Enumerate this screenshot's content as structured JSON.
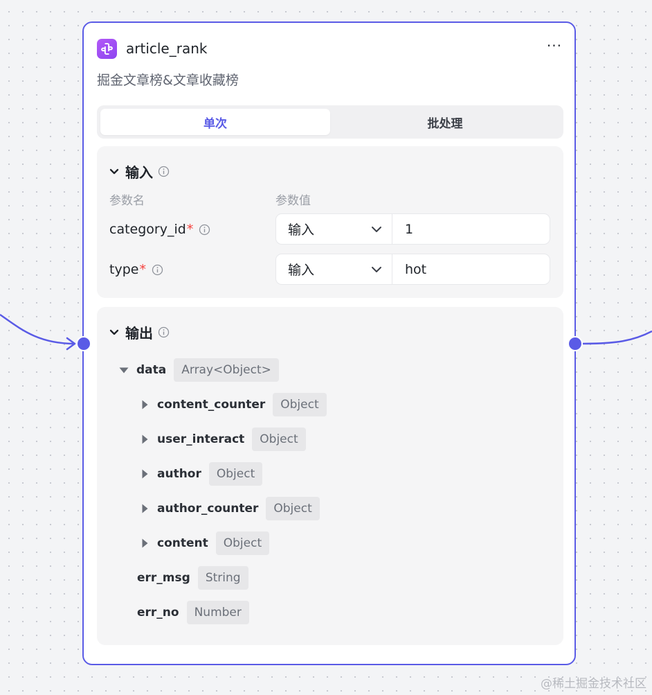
{
  "node": {
    "title": "article_rank",
    "description": "掘金文章榜&文章收藏榜",
    "icon": "plugin-icon",
    "accent_color": "#5a5be6",
    "icon_color": "#a050f5"
  },
  "modes": {
    "single_label": "单次",
    "batch_label": "批处理",
    "active": "单次"
  },
  "input": {
    "title": "输入",
    "col_name": "参数名",
    "col_value": "参数值",
    "params": [
      {
        "name": "category_id",
        "required": "*",
        "source": "输入",
        "value": "1"
      },
      {
        "name": "type",
        "required": "*",
        "source": "输入",
        "value": "hot"
      }
    ]
  },
  "output": {
    "title": "输出",
    "fields": [
      {
        "name": "data",
        "type": "Array<Object>",
        "expanded": true
      },
      {
        "name": "content_counter",
        "type": "Object"
      },
      {
        "name": "user_interact",
        "type": "Object"
      },
      {
        "name": "author",
        "type": "Object"
      },
      {
        "name": "author_counter",
        "type": "Object"
      },
      {
        "name": "content",
        "type": "Object"
      },
      {
        "name": "err_msg",
        "type": "String"
      },
      {
        "name": "err_no",
        "type": "Number"
      }
    ]
  },
  "watermark": "@稀土掘金技术社区"
}
